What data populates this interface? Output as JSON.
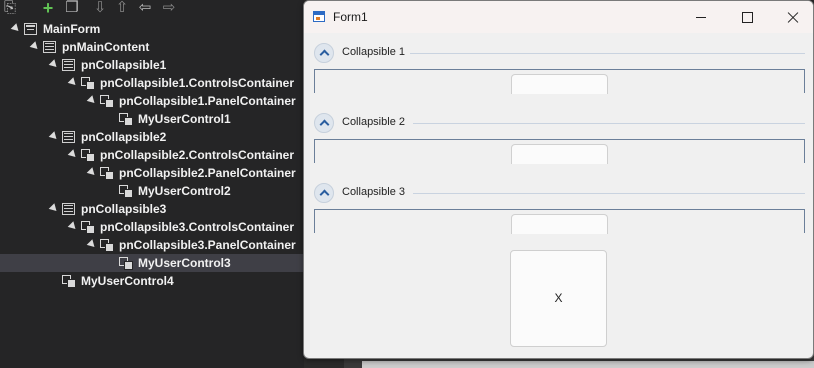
{
  "outline": {
    "toolbar": {
      "icons": [
        "copy-icon",
        "add-icon",
        "stack-icon",
        "move-down-icon",
        "move-up-icon",
        "move-left-icon",
        "move-right-icon"
      ]
    },
    "tree": [
      {
        "label": "MainForm",
        "icon": "form-icon",
        "expanded": true,
        "depth": 0
      },
      {
        "label": "pnMainContent",
        "icon": "panel-icon",
        "expanded": true,
        "depth": 1
      },
      {
        "label": "pnCollapsible1",
        "icon": "panel-icon",
        "expanded": true,
        "depth": 2
      },
      {
        "label": "pnCollapsible1.ControlsContainer",
        "icon": "control-icon",
        "expanded": true,
        "depth": 3
      },
      {
        "label": "pnCollapsible1.PanelContainer",
        "icon": "control-icon",
        "expanded": true,
        "depth": 4
      },
      {
        "label": "MyUserControl1",
        "icon": "control-icon",
        "expanded": false,
        "depth": 5
      },
      {
        "label": "pnCollapsible2",
        "icon": "panel-icon",
        "expanded": true,
        "depth": 2
      },
      {
        "label": "pnCollapsible2.ControlsContainer",
        "icon": "control-icon",
        "expanded": true,
        "depth": 3
      },
      {
        "label": "pnCollapsible2.PanelContainer",
        "icon": "control-icon",
        "expanded": true,
        "depth": 4
      },
      {
        "label": "MyUserControl2",
        "icon": "control-icon",
        "expanded": false,
        "depth": 5
      },
      {
        "label": "pnCollapsible3",
        "icon": "panel-icon",
        "expanded": true,
        "depth": 2
      },
      {
        "label": "pnCollapsible3.ControlsContainer",
        "icon": "control-icon",
        "expanded": true,
        "depth": 3
      },
      {
        "label": "pnCollapsible3.PanelContainer",
        "icon": "control-icon",
        "expanded": true,
        "depth": 4
      },
      {
        "label": "MyUserControl3",
        "icon": "control-icon",
        "expanded": false,
        "depth": 5,
        "selected": true
      },
      {
        "label": "MyUserControl4",
        "icon": "control-icon",
        "expanded": false,
        "depth": 2
      }
    ]
  },
  "form": {
    "title": "Form1",
    "sections": [
      {
        "label": "Collapsible 1"
      },
      {
        "label": "Collapsible 2"
      },
      {
        "label": "Collapsible 3"
      }
    ],
    "user_control_4_text": "X"
  },
  "colors": {
    "outline_bg": "#252526",
    "selection_bg": "#3f3f46",
    "form_bg": "#f0f0f0",
    "accent": "#2a5d9f"
  }
}
